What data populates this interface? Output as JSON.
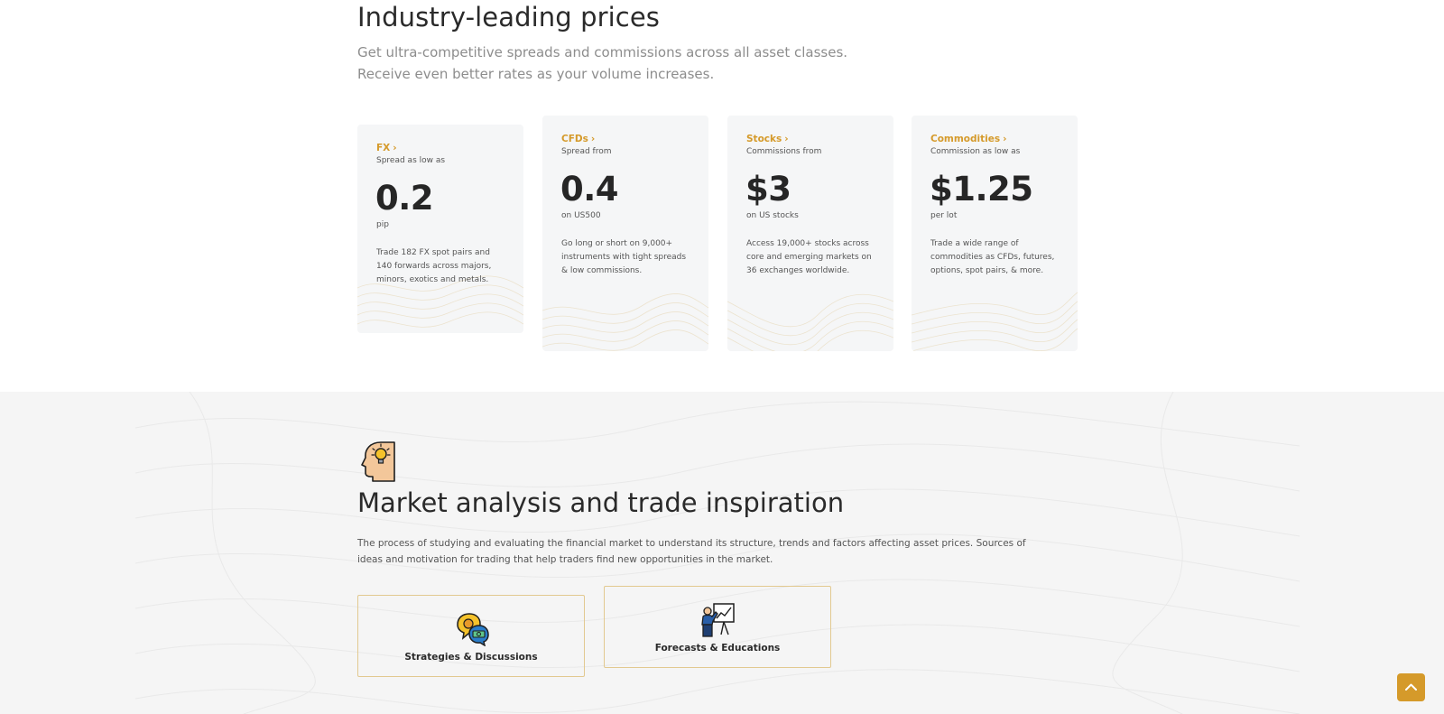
{
  "pricing": {
    "title_part1": "Industry-",
    "title_highlight": "leading",
    "title_part2": " prices",
    "subtitle_line1": "Get ultra-competitive spreads and commissions across all asset classes.",
    "subtitle_line2": "Receive even better rates as your volume increases.",
    "cards": [
      {
        "category": "FX",
        "label": "Spread as low as",
        "value": "0.2",
        "unit": "pip",
        "description": "Trade 182 FX spot pairs and 140 forwards across majors, minors, exotics and metals."
      },
      {
        "category": "CFDs",
        "label": "Spread from",
        "value": "0.4",
        "unit": "on US500",
        "description": "Go long or short on 9,000+ instruments with tight spreads & low commissions."
      },
      {
        "category": "Stocks",
        "label": "Commissions from",
        "value": "$3",
        "unit": "on US stocks",
        "description": "Access 19,000+ stocks across core and emerging markets on 36 exchanges worldwide."
      },
      {
        "category": "Commodities",
        "label": "Commission as low as",
        "value": "$1.25",
        "unit": "per lot",
        "description": "Trade a wide range of commodities as CFDs, futures, options, spot pairs, & more."
      }
    ]
  },
  "analysis": {
    "icon": "head-lightbulb-icon",
    "title_part1": "Market ",
    "title_highlight": "analysis",
    "title_part2": " and trade inspiration",
    "description": "The process of studying and evaluating the financial market to understand its structure, trends and factors affecting asset prices. Sources of ideas and motivation for trading that help traders find new opportunities in the market.",
    "buttons": [
      {
        "label": "Strategies & Discussions",
        "icon": "chat-bubbles-icon"
      },
      {
        "label": "Forecasts & Educations",
        "icon": "presentation-chart-icon"
      }
    ]
  },
  "scroll_top": {
    "icon": "chevron-up-icon"
  },
  "colors": {
    "accent": "#d59a2a",
    "highlight": "#f1e0bd",
    "card_bg": "#f5f6f7",
    "section_bg": "#f5f5f5",
    "border": "#e2c990"
  }
}
